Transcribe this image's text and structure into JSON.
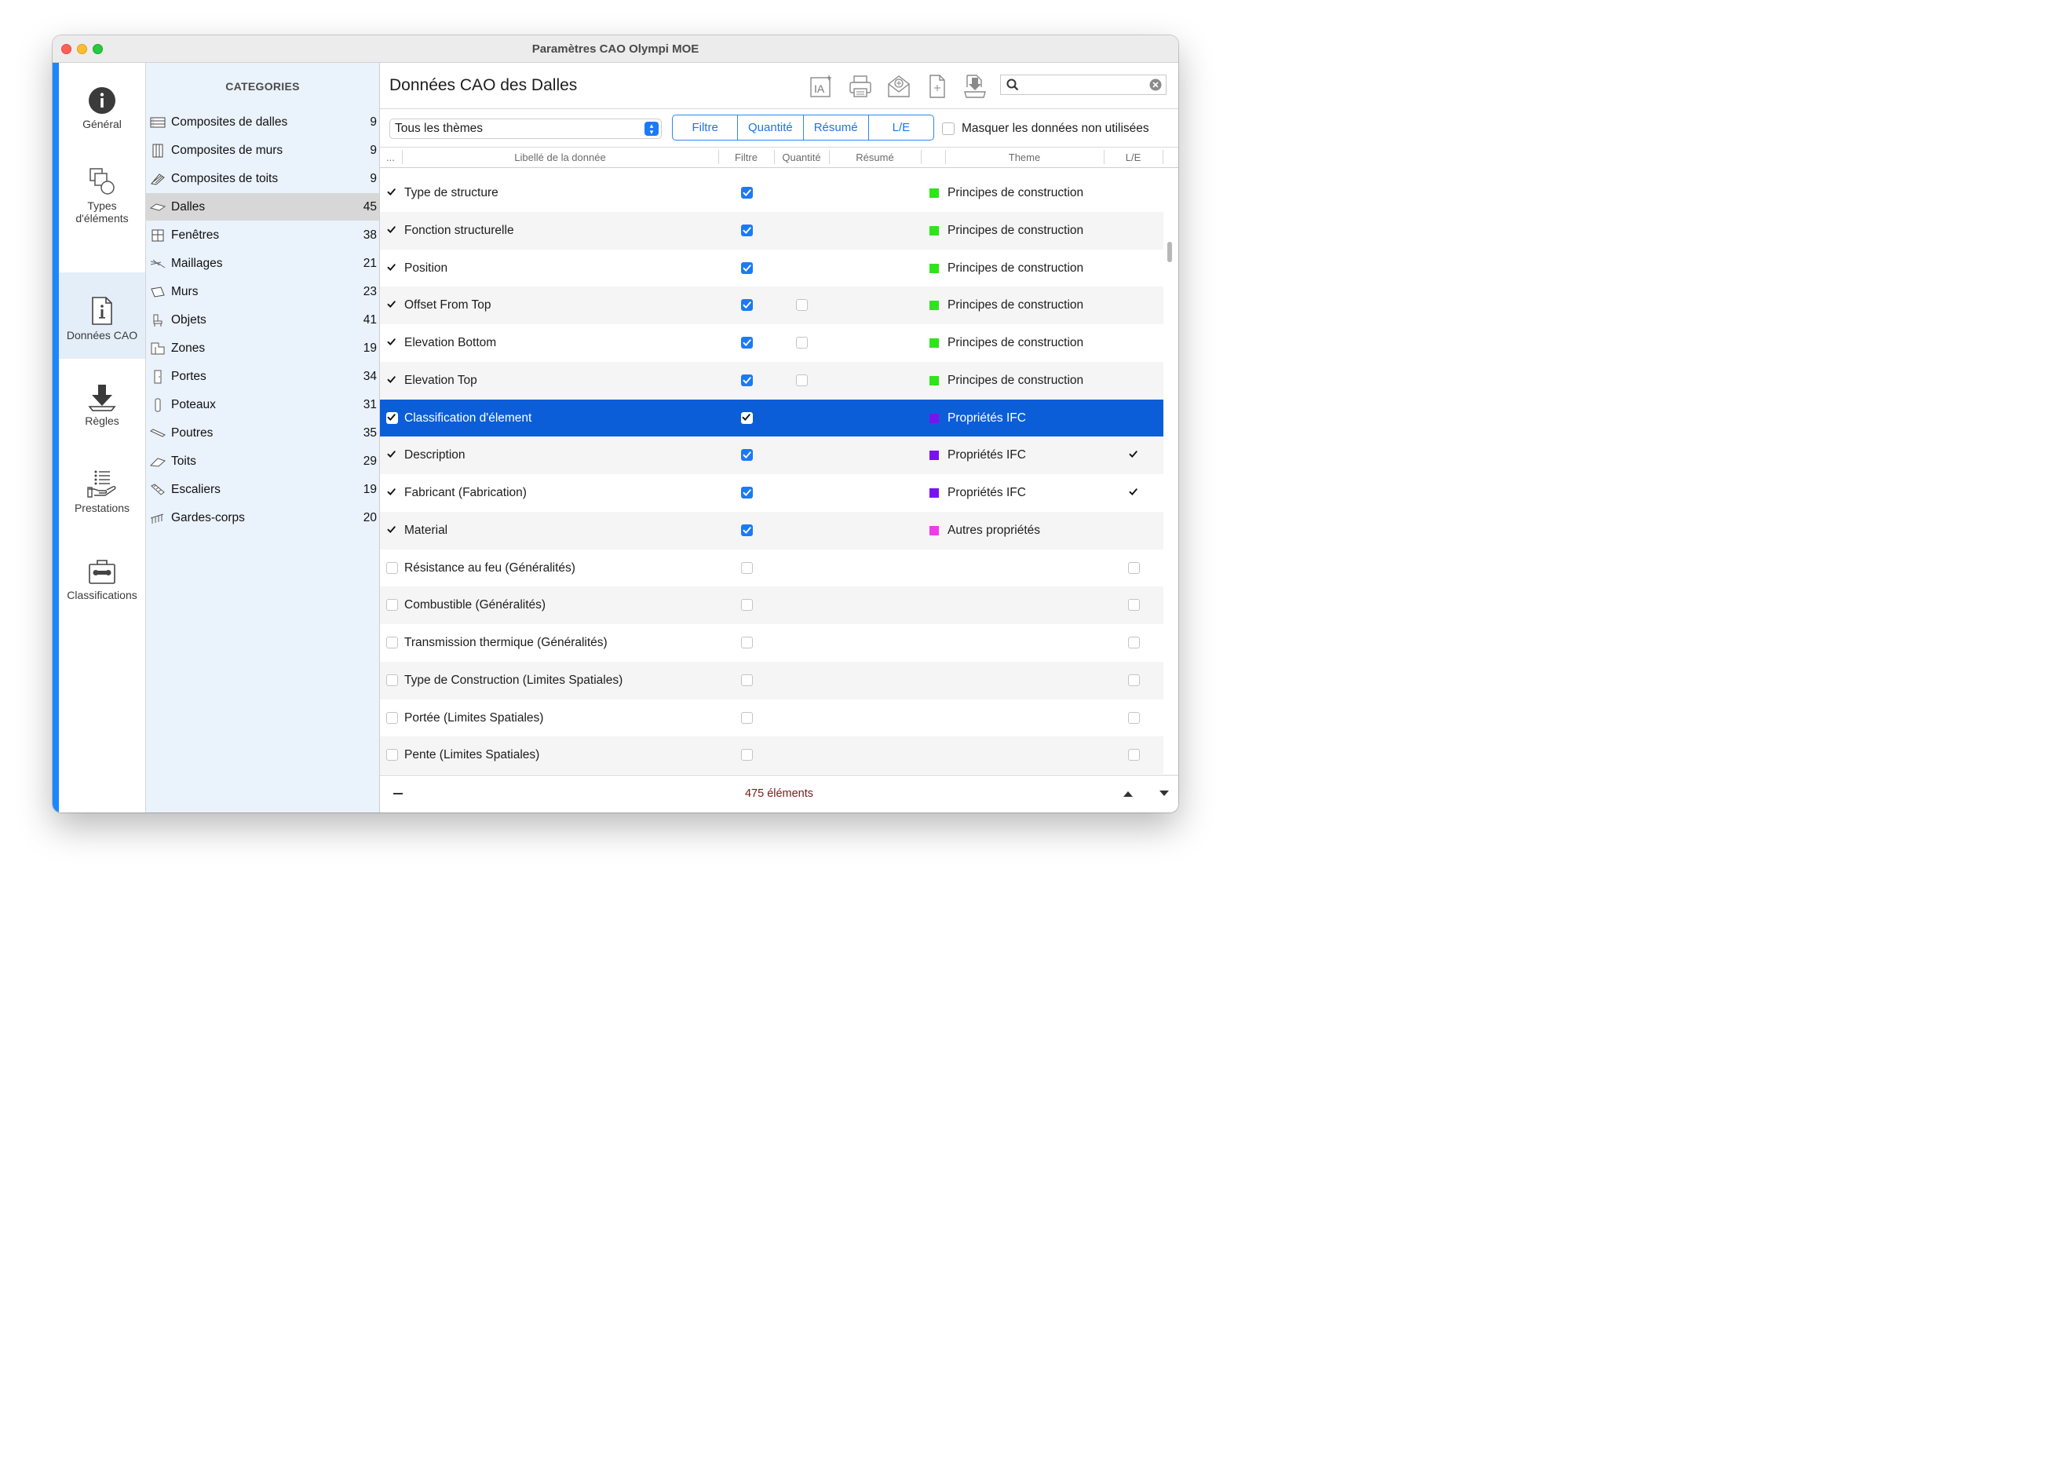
{
  "window": {
    "title": "Paramètres CAO Olympi MOE"
  },
  "nav": {
    "items": [
      {
        "label": "Général",
        "icon": "info-icon"
      },
      {
        "label": "Types d'éléments",
        "icon": "shapes-icon"
      },
      {
        "label": "Données CAO",
        "icon": "info-document-icon"
      },
      {
        "label": "Règles",
        "icon": "download-arrow-icon"
      },
      {
        "label": "Prestations",
        "icon": "hand-list-icon"
      },
      {
        "label": "Classifications",
        "icon": "toolbox-icon"
      }
    ],
    "selected": "Données CAO"
  },
  "categories": {
    "header": "CATEGORIES",
    "items": [
      {
        "label": "Composites de dalles",
        "count": "9",
        "icon": "slab-composite-icon"
      },
      {
        "label": "Composites de murs",
        "count": "9",
        "icon": "wall-composite-icon"
      },
      {
        "label": "Composites de toits",
        "count": "9",
        "icon": "roof-composite-icon"
      },
      {
        "label": "Dalles",
        "count": "45",
        "icon": "slab-icon"
      },
      {
        "label": "Fenêtres",
        "count": "38",
        "icon": "window-icon"
      },
      {
        "label": "Maillages",
        "count": "21",
        "icon": "mesh-icon"
      },
      {
        "label": "Murs",
        "count": "23",
        "icon": "wall-icon"
      },
      {
        "label": "Objets",
        "count": "41",
        "icon": "object-icon"
      },
      {
        "label": "Zones",
        "count": "19",
        "icon": "zone-icon"
      },
      {
        "label": "Portes",
        "count": "34",
        "icon": "door-icon"
      },
      {
        "label": "Poteaux",
        "count": "31",
        "icon": "column-icon"
      },
      {
        "label": "Poutres",
        "count": "35",
        "icon": "beam-icon"
      },
      {
        "label": "Toits",
        "count": "29",
        "icon": "roof-icon"
      },
      {
        "label": "Escaliers",
        "count": "19",
        "icon": "stairs-icon"
      },
      {
        "label": "Gardes-corps",
        "count": "20",
        "icon": "railing-icon"
      }
    ],
    "selected": "Dalles"
  },
  "main": {
    "title": "Données CAO des Dalles",
    "toolbar": [
      "ia-icon",
      "print-icon",
      "mail-icon",
      "new-file-icon",
      "export-icon"
    ],
    "search": {
      "placeholder": "",
      "value": ""
    },
    "theme_select": {
      "value": "Tous les thèmes"
    },
    "segments": [
      "Filtre",
      "Quantité",
      "Résumé",
      "L/E"
    ],
    "hide_unused_label": "Masquer les données non utilisées",
    "columns": {
      "more": "...",
      "label": "Libellé de la donnée",
      "filtre": "Filtre",
      "quantite": "Quantité",
      "resume": "Résumé",
      "theme": "Theme",
      "le": "L/E"
    },
    "rows": [
      {
        "checked": true,
        "label": "Type de structure",
        "filtre": "on",
        "quantite": "",
        "theme": "Principes de construction",
        "color": "#2ee51a",
        "le": ""
      },
      {
        "checked": true,
        "label": "Fonction structurelle",
        "filtre": "on",
        "quantite": "",
        "theme": "Principes de construction",
        "color": "#2ee51a",
        "le": ""
      },
      {
        "checked": true,
        "label": "Position",
        "filtre": "on",
        "quantite": "",
        "theme": "Principes de construction",
        "color": "#2ee51a",
        "le": ""
      },
      {
        "checked": true,
        "label": "Offset From Top",
        "filtre": "on",
        "quantite": "off",
        "theme": "Principes de construction",
        "color": "#2ee51a",
        "le": ""
      },
      {
        "checked": true,
        "label": "Elevation Bottom",
        "filtre": "on",
        "quantite": "off",
        "theme": "Principes de construction",
        "color": "#2ee51a",
        "le": ""
      },
      {
        "checked": true,
        "label": "Elevation Top",
        "filtre": "on",
        "quantite": "off",
        "theme": "Principes de construction",
        "color": "#2ee51a",
        "le": ""
      },
      {
        "checked": true,
        "label": "Classification d'élement",
        "filtre": "on",
        "quantite": "",
        "theme": "Propriétés IFC",
        "color": "#7a12f0",
        "le": "",
        "selected": true
      },
      {
        "checked": true,
        "label": "Description",
        "filtre": "on",
        "quantite": "",
        "theme": "Propriétés IFC",
        "color": "#7a12f0",
        "le": "on"
      },
      {
        "checked": true,
        "label": "Fabricant (Fabrication)",
        "filtre": "on",
        "quantite": "",
        "theme": "Propriétés IFC",
        "color": "#7a12f0",
        "le": "on"
      },
      {
        "checked": true,
        "label": "Material",
        "filtre": "on",
        "quantite": "",
        "theme": "Autres propriétés",
        "color": "#f23be8",
        "le": ""
      },
      {
        "checked": false,
        "label": "Résistance au feu (Généralités)",
        "filtre": "off",
        "quantite": "",
        "theme": "",
        "color": "",
        "le": "off"
      },
      {
        "checked": false,
        "label": "Combustible (Généralités)",
        "filtre": "off",
        "quantite": "",
        "theme": "",
        "color": "",
        "le": "off"
      },
      {
        "checked": false,
        "label": "Transmission thermique (Généralités)",
        "filtre": "off",
        "quantite": "",
        "theme": "",
        "color": "",
        "le": "off"
      },
      {
        "checked": false,
        "label": "Type de Construction (Limites Spatiales)",
        "filtre": "off",
        "quantite": "",
        "theme": "",
        "color": "",
        "le": "off"
      },
      {
        "checked": false,
        "label": "Portée (Limites Spatiales)",
        "filtre": "off",
        "quantite": "",
        "theme": "",
        "color": "",
        "le": "off"
      },
      {
        "checked": false,
        "label": "Pente (Limites Spatiales)",
        "filtre": "off",
        "quantite": "",
        "theme": "",
        "color": "",
        "le": "off"
      }
    ],
    "footer": {
      "count": "475 éléments"
    }
  },
  "colors": {
    "accent": "#1b7af5",
    "selection": "#0b5ed8",
    "nav_accent": "#1b87ff",
    "category_bg": "#eaf2fb"
  }
}
